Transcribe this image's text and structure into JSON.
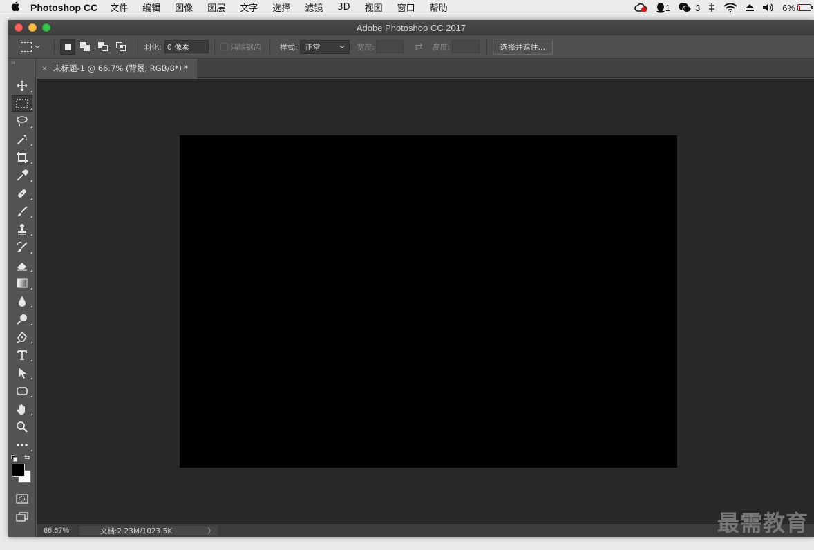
{
  "menubar": {
    "apple_icon": "apple-icon",
    "app_name": "Photoshop CC",
    "items": [
      "文件",
      "编辑",
      "图像",
      "图层",
      "文字",
      "选择",
      "滤镜",
      "3D",
      "视图",
      "窗口",
      "帮助"
    ],
    "status": {
      "qq_count": "1",
      "wechat_count": "3",
      "battery": "6%"
    }
  },
  "window": {
    "title": "Adobe Photoshop CC 2017"
  },
  "options": {
    "feather_label": "羽化:",
    "feather_value": "0 像素",
    "antialias_label": "消除锯齿",
    "style_label": "样式:",
    "style_value": "正常",
    "width_label": "宽度:",
    "height_label": "高度:",
    "select_mask_button": "选择并遮住..."
  },
  "tools": {
    "panel_grip": "››",
    "list": [
      "move",
      "rectangular-marquee",
      "lasso",
      "magic-wand",
      "crop",
      "eyedropper",
      "healing-brush",
      "brush",
      "clone-stamp",
      "history-brush",
      "eraser",
      "gradient",
      "blur",
      "dodge",
      "pen",
      "type",
      "path-selection",
      "rectangle",
      "hand",
      "zoom",
      "more"
    ],
    "active": "rectangular-marquee",
    "foreground_color": "#000000",
    "background_color": "#ffffff"
  },
  "document": {
    "tab_title": "未标题-1 @ 66.7% (背景, RGB/8*) *",
    "canvas_color": "#000000"
  },
  "statusbar": {
    "zoom": "66.67%",
    "doc_info": "文档:2.23M/1023.5K",
    "arrow": "〉"
  },
  "watermark": "最需教育"
}
